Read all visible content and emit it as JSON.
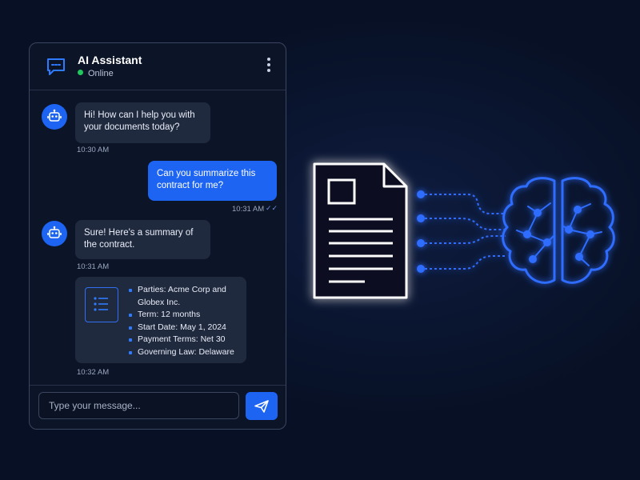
{
  "chat": {
    "title": "AI Assistant",
    "status": "Online",
    "messages": [
      {
        "sender": "bot",
        "text": "Hi! How can I help you with your documents today?",
        "time": "10:30 AM"
      },
      {
        "sender": "user",
        "text": "Can you summarize this contract for me?",
        "time": "10:31 AM",
        "read_receipt": "✓✓"
      },
      {
        "sender": "bot",
        "text": "Sure! Here's a summary of the contract.",
        "time": "10:31 AM"
      }
    ],
    "summary": {
      "items": [
        "Parties: Acme Corp and Globex Inc.",
        "Term: 12 months",
        "Start Date: May 1, 2024",
        "Payment Terms: Net 30",
        "Governing Law: Delaware"
      ],
      "time": "10:32 AM"
    },
    "input": {
      "placeholder": "Type your message...",
      "value": ""
    }
  },
  "icons": {
    "header": "chat-bubble-icon",
    "menu": "kebab-menu-icon",
    "avatar": "robot-icon",
    "summary": "list-icon",
    "send": "paper-plane-icon",
    "illustration_left": "document-icon",
    "illustration_right": "brain-circuit-icon"
  },
  "colors": {
    "background": "#071024",
    "accent": "#1d64f2",
    "online": "#22c55e",
    "bot_bubble": "#202a3e",
    "glow": "#2f6dff"
  }
}
